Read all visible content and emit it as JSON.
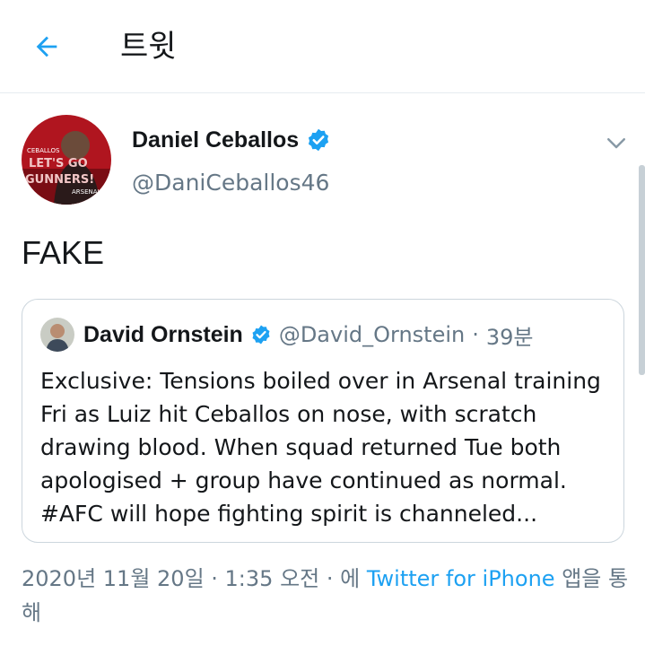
{
  "header": {
    "title": "트윗",
    "back_icon": "arrow-left-icon"
  },
  "tweet": {
    "author_name": "Daniel Ceballos",
    "author_handle": "@DaniCeballos46",
    "verified": true,
    "avatar_text": [
      "CEBALLOS",
      "LET'S GO",
      "GUNNERS!",
      "ARSENAL"
    ],
    "text": "FAKE"
  },
  "quoted": {
    "author_name": "David Ornstein",
    "author_handle": "@David_Ornstein",
    "separator": "·",
    "time": "39분",
    "verified": true,
    "body": "Exclusive: Tensions boiled over in Arsenal training Fri as Luiz hit Ceballos on nose, with scratch drawing blood. When squad returned Tue both apologised + group have continued as normal. #AFC will hope fighting spirit is channeled..."
  },
  "meta": {
    "datetime": "2020년 11월 20일 · 1:35 오전 · 에",
    "source": "Twitter for iPhone",
    "suffix": "앱을 통해"
  },
  "colors": {
    "accent": "#1da1f2",
    "secondary_text": "#657786",
    "border": "#e6ecf0"
  }
}
